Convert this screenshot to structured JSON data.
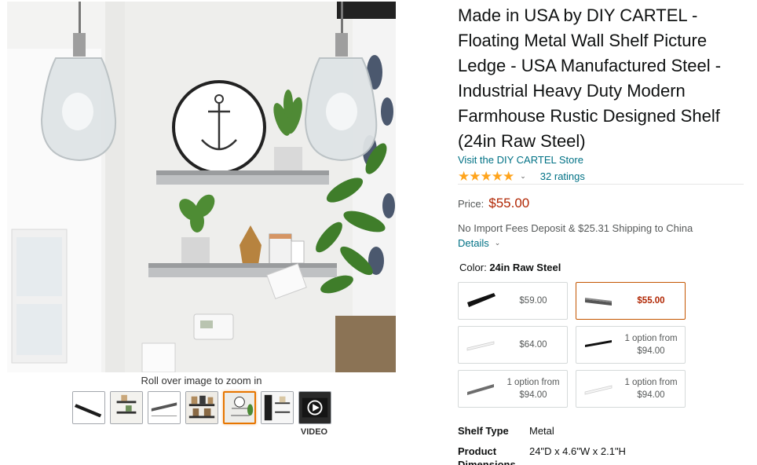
{
  "gallery": {
    "zoom_hint": "Roll over image to zoom in",
    "thumbnails": [
      {
        "name": "thumbnail-shelf-black",
        "selected": false
      },
      {
        "name": "thumbnail-shelf-lifestyle",
        "selected": false
      },
      {
        "name": "thumbnail-shelf-dimensions",
        "selected": false
      },
      {
        "name": "thumbnail-shelf-frames",
        "selected": false
      },
      {
        "name": "thumbnail-shelf-wall-decor",
        "selected": true
      },
      {
        "name": "thumbnail-shelf-room",
        "selected": false
      },
      {
        "name": "thumbnail-video",
        "selected": false
      }
    ],
    "video_label": "VIDEO"
  },
  "product": {
    "title": "Made in USA by DIY CARTEL - Floating Metal Wall Shelf Picture Ledge - USA Manufactured Steel - Industrial Heavy Duty Modern Farmhouse Rustic Designed Shelf (24in Raw Steel)",
    "store_link": "Visit the DIY CARTEL Store",
    "rating_stars": "4.5",
    "ratings_count": "32 ratings",
    "price_label": "Price:",
    "price": "$55.00",
    "shipping": "No Import Fees Deposit & $25.31 Shipping to China",
    "details_link": "Details",
    "color_label": "Color:",
    "color_value": "24in Raw Steel"
  },
  "swatches": [
    {
      "price": "$59.00",
      "finish": "black",
      "selected": false
    },
    {
      "price": "$55.00",
      "finish": "raw-steel",
      "selected": true
    },
    {
      "price": "$64.00",
      "finish": "white",
      "selected": false
    },
    {
      "line1": "1 option from",
      "line2": "$94.00",
      "finish": "black",
      "selected": false
    },
    {
      "line1": "1 option from",
      "line2": "$94.00",
      "finish": "raw-steel",
      "selected": false
    },
    {
      "line1": "1 option from",
      "line2": "$94.00",
      "finish": "white",
      "selected": false
    }
  ],
  "specs": [
    {
      "label": "Shelf Type",
      "value": "Metal"
    },
    {
      "label": "Product",
      "value": "24\"D x 4.6\"W x 2.1\"H"
    },
    {
      "label": "Dimensions",
      "value": ""
    }
  ],
  "colors": {
    "link": "#007185",
    "price": "#b12704",
    "star": "#ffa41c",
    "selected_border": "#c45500"
  }
}
